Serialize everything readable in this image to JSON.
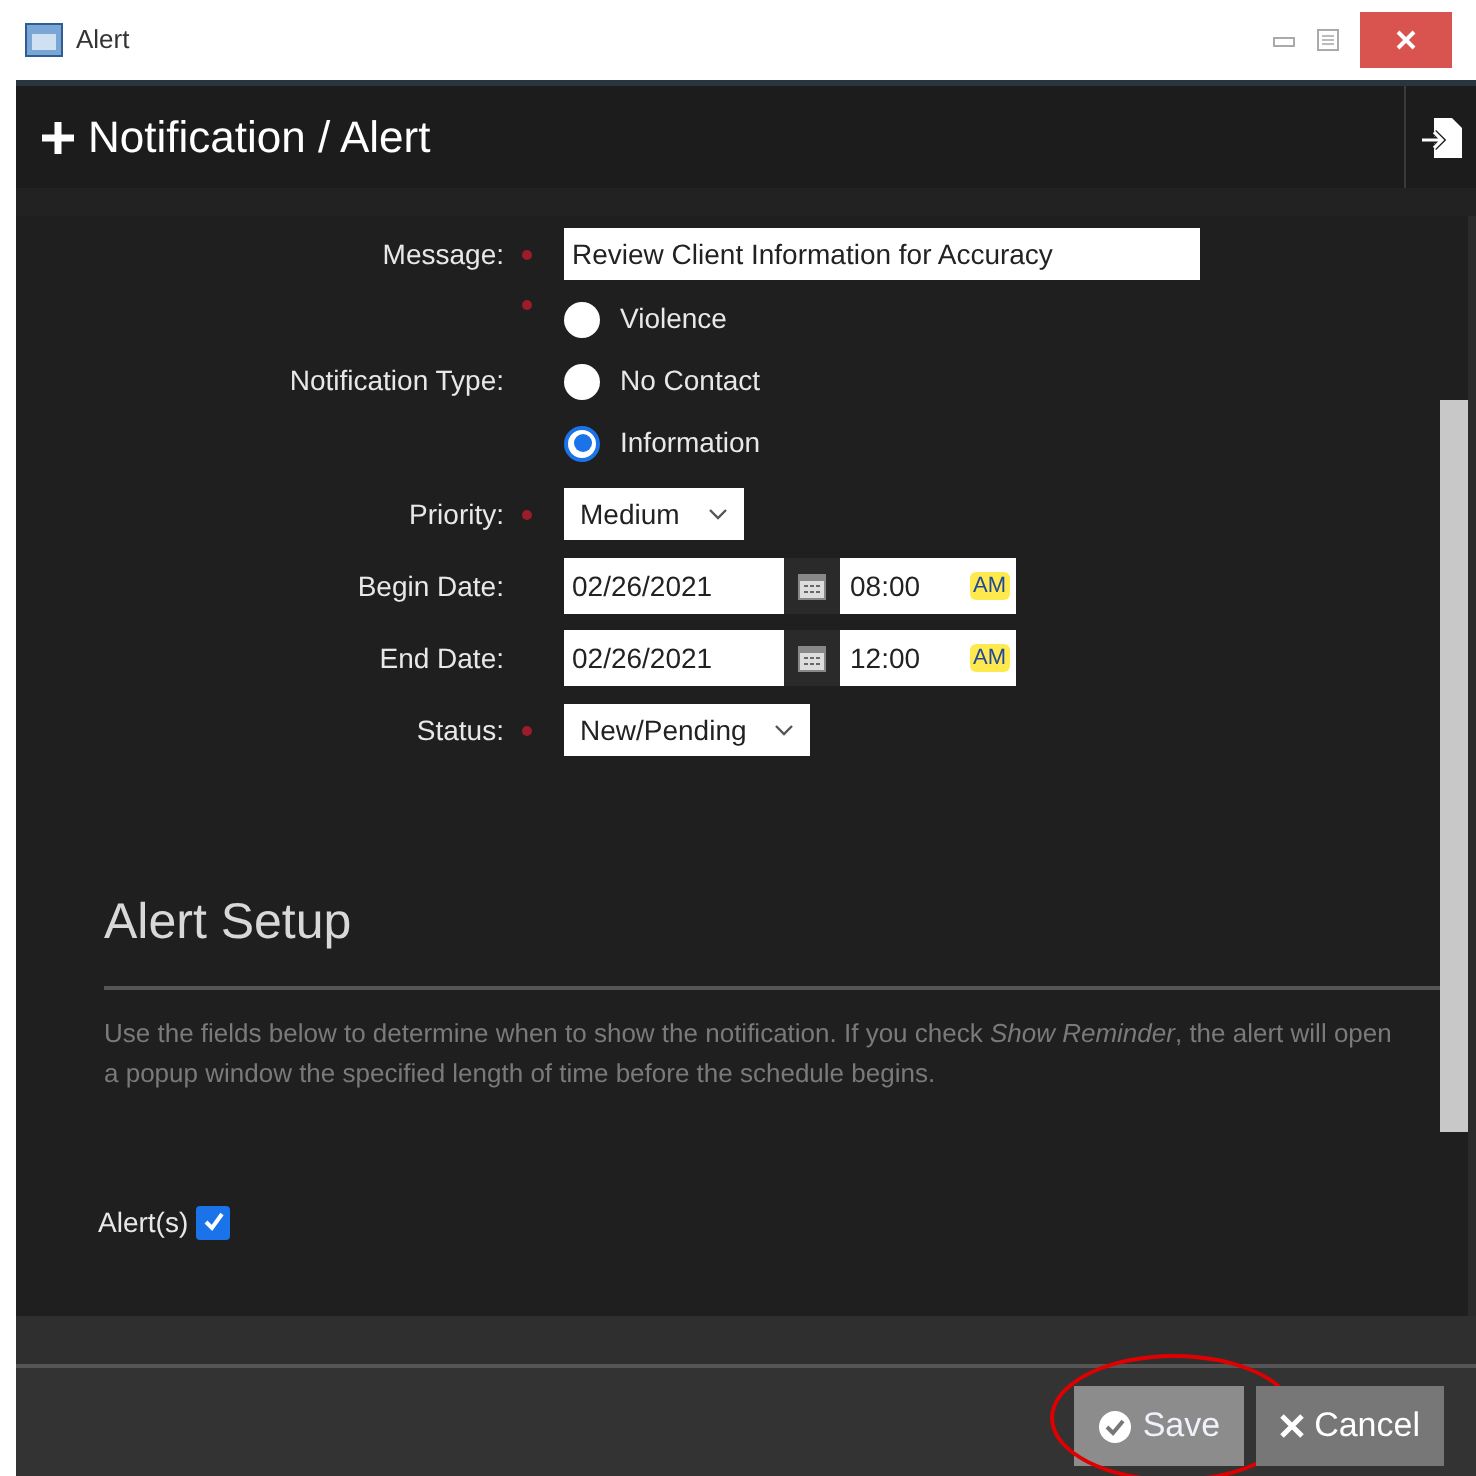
{
  "window": {
    "title": "Alert"
  },
  "header": {
    "title": "Notification / Alert"
  },
  "fields": [
    {
      "kind": "text",
      "label": "Message:",
      "required": true,
      "value": "Review Client Information for Accuracy"
    },
    {
      "kind": "radio",
      "label": "Notification Type:",
      "required": true,
      "options": [
        {
          "label": "Violence",
          "selected": false
        },
        {
          "label": "No Contact",
          "selected": false
        },
        {
          "label": "Information",
          "selected": true
        }
      ]
    },
    {
      "kind": "select",
      "label": "Priority:",
      "required": true,
      "value": "Medium"
    },
    {
      "kind": "datetime",
      "label": "Begin Date:",
      "required": false,
      "date": "02/26/2021",
      "time": "08:00",
      "meridiem": "AM"
    },
    {
      "kind": "datetime",
      "label": "End Date:",
      "required": false,
      "date": "02/26/2021",
      "time": "12:00",
      "meridiem": "AM"
    },
    {
      "kind": "select",
      "label": "Status:",
      "required": true,
      "value": "New/Pending"
    }
  ],
  "section": {
    "title": "Alert Setup",
    "description": "Use the fields below to determine when to show the notification. If you check *Show Reminder*, the alert will open a popup window the specified length of time before the schedule begins."
  },
  "alerts_checkbox": {
    "label": "Alert(s)",
    "checked": true
  },
  "buttons": [
    {
      "kind": "save",
      "label": "Save",
      "highlighted": true
    },
    {
      "kind": "cancel",
      "label": "Cancel",
      "highlighted": false
    }
  ]
}
